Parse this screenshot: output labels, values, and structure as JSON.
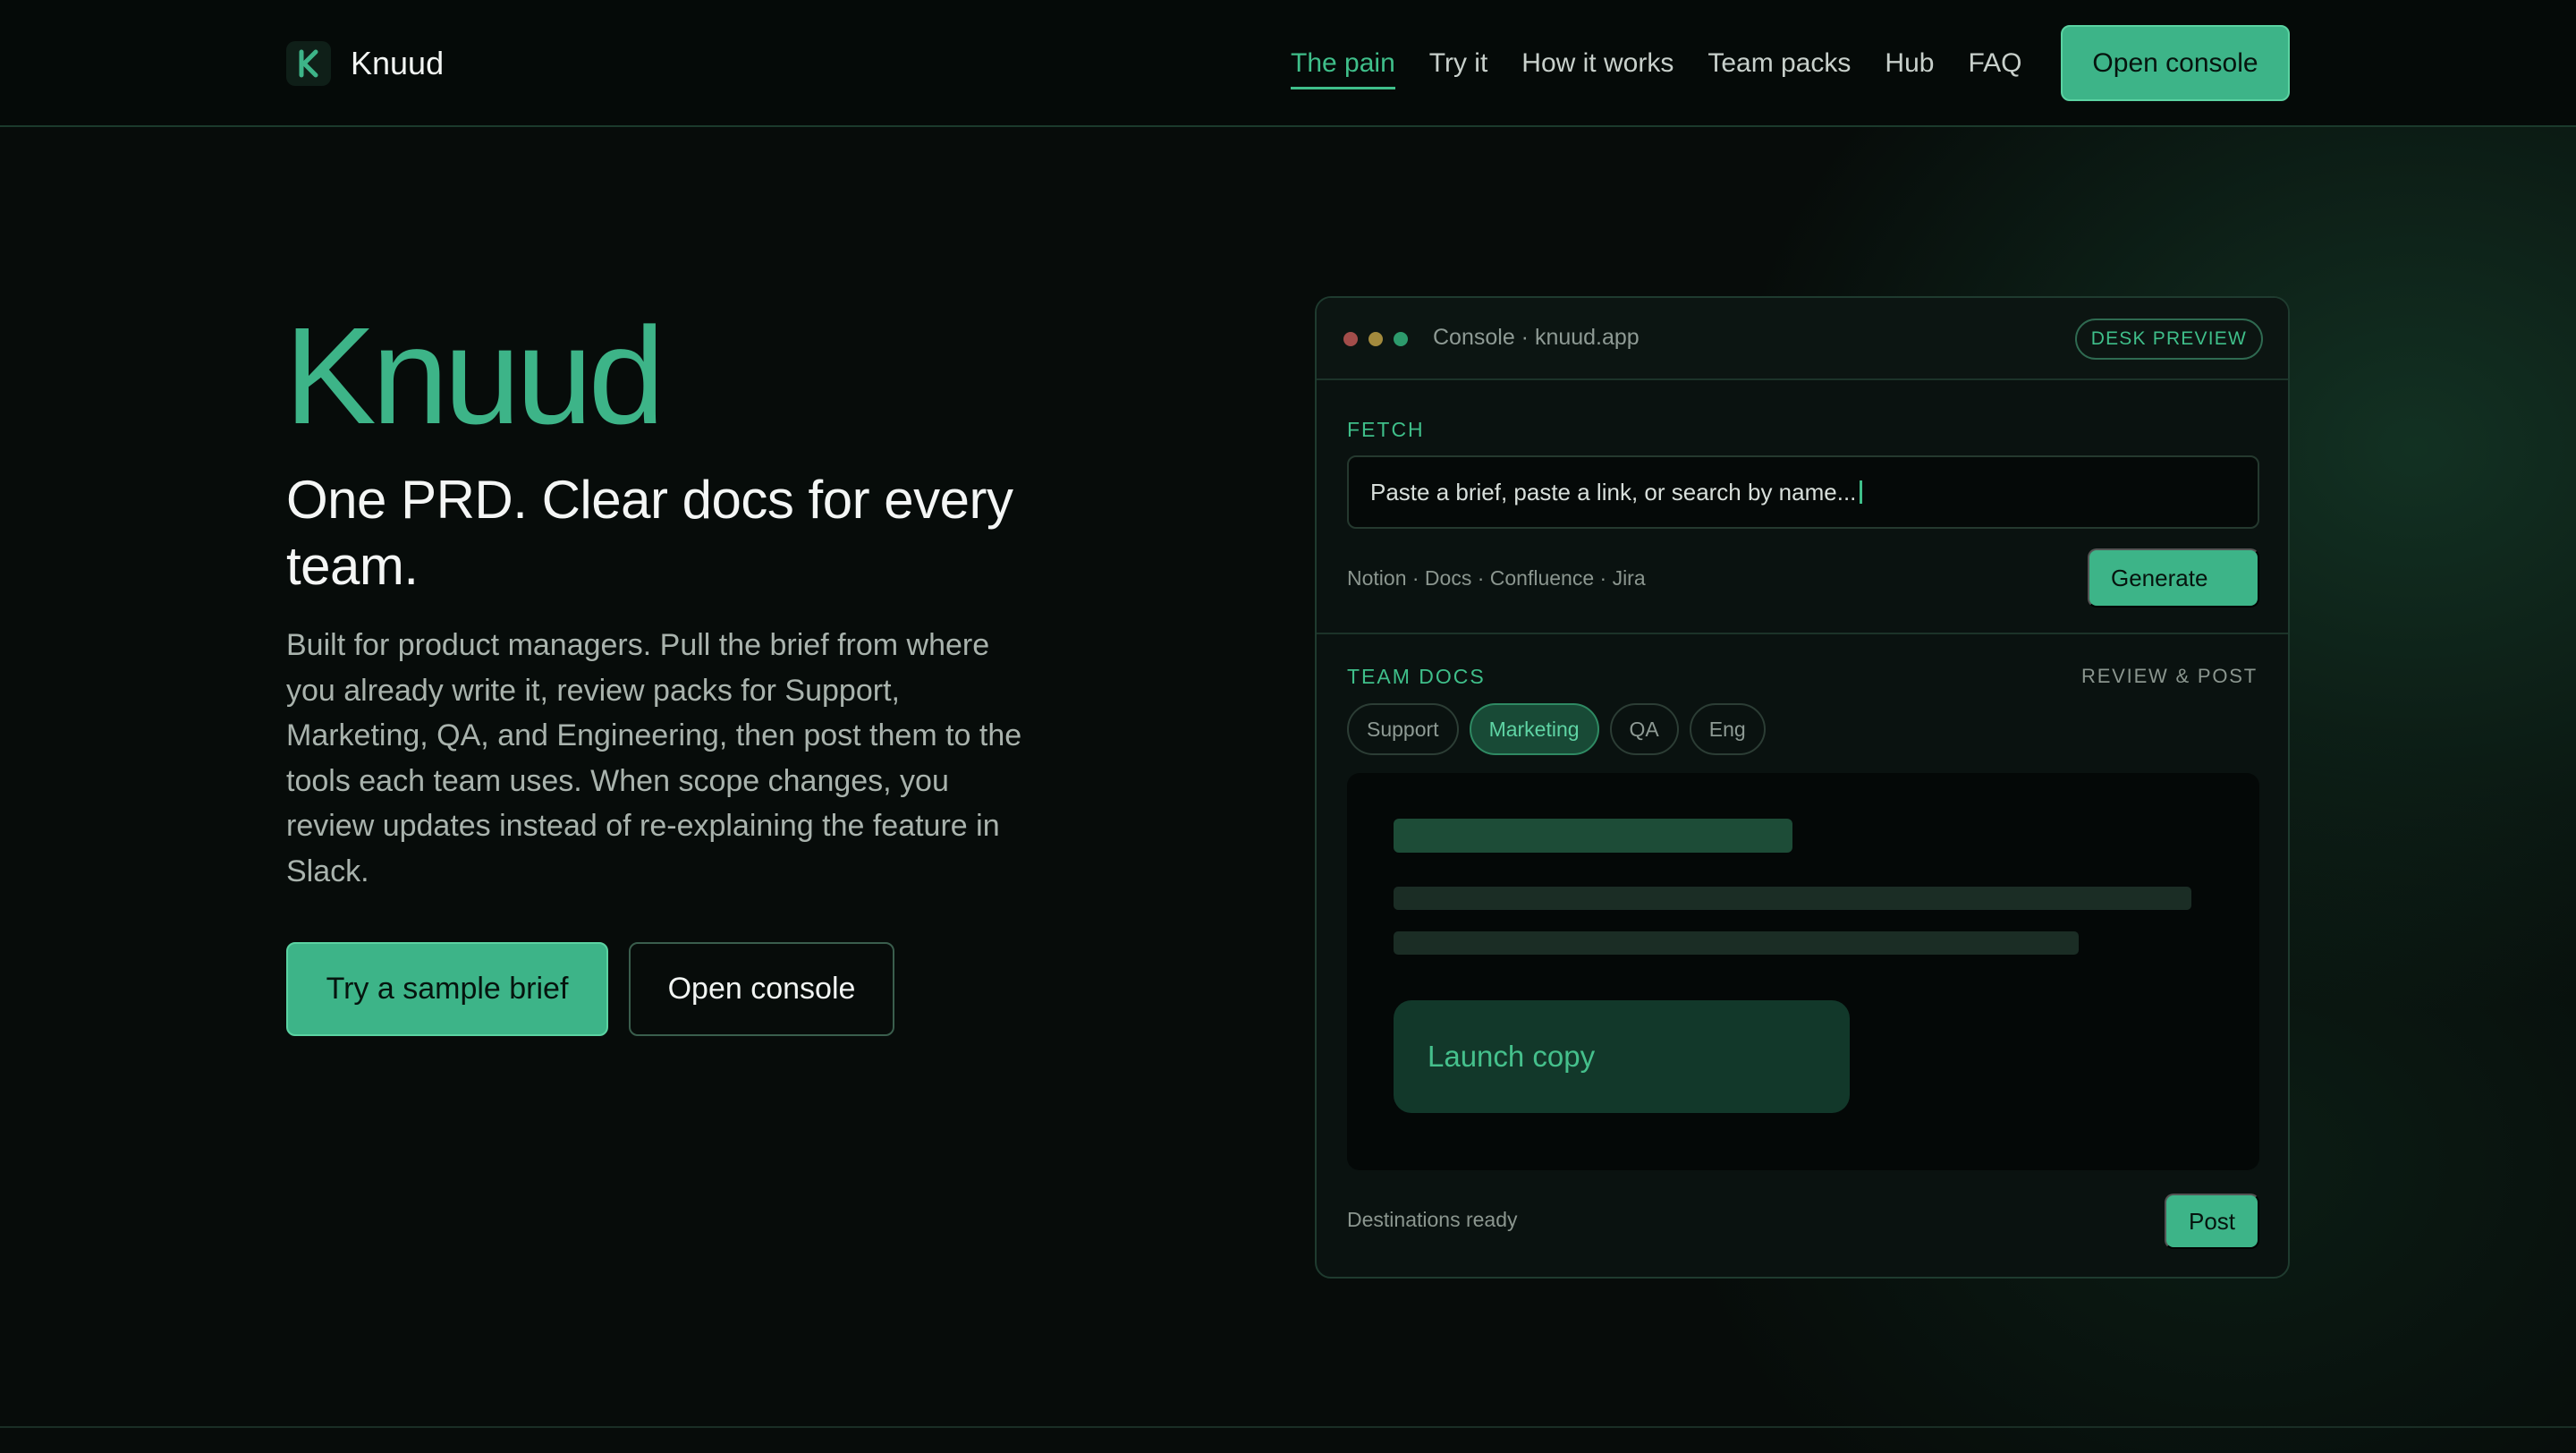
{
  "nav": {
    "brand": "Knuud",
    "links": [
      {
        "label": "The pain",
        "active": true
      },
      {
        "label": "Try it",
        "active": false
      },
      {
        "label": "How it works",
        "active": false
      },
      {
        "label": "Team packs",
        "active": false
      },
      {
        "label": "Hub",
        "active": false
      },
      {
        "label": "FAQ",
        "active": false
      }
    ],
    "cta": "Open console"
  },
  "hero": {
    "title": "Knuud",
    "subtitle": "One PRD. Clear docs for every team.",
    "body": "Built for product managers. Pull the brief from where you already write it, review packs for Support, Marketing, QA, and Engineering, then post them to the tools each team uses. When scope changes, you review updates instead of re-explaining the feature in Slack.",
    "primary_button": "Try a sample brief",
    "secondary_button": "Open console"
  },
  "console": {
    "window_title": "Console · knuud.app",
    "badge": "DESK PREVIEW",
    "fetch_label": "FETCH",
    "fetch_placeholder": "Paste a brief, paste a link, or search by name...",
    "sources": "Notion · Docs · Confluence · Jira",
    "generate_button": "Generate",
    "team_docs_label": "TEAM DOCS",
    "review_label": "REVIEW & POST",
    "tabs": [
      {
        "label": "Support",
        "active": false
      },
      {
        "label": "Marketing",
        "active": true
      },
      {
        "label": "QA",
        "active": false
      },
      {
        "label": "Eng",
        "active": false
      }
    ],
    "preview_card_label": "Launch copy",
    "status": "Destinations ready",
    "post_button": "Post"
  },
  "colors": {
    "accent": "#3db488",
    "background": "#070c0a",
    "muted_text": "#a9b3ad"
  }
}
